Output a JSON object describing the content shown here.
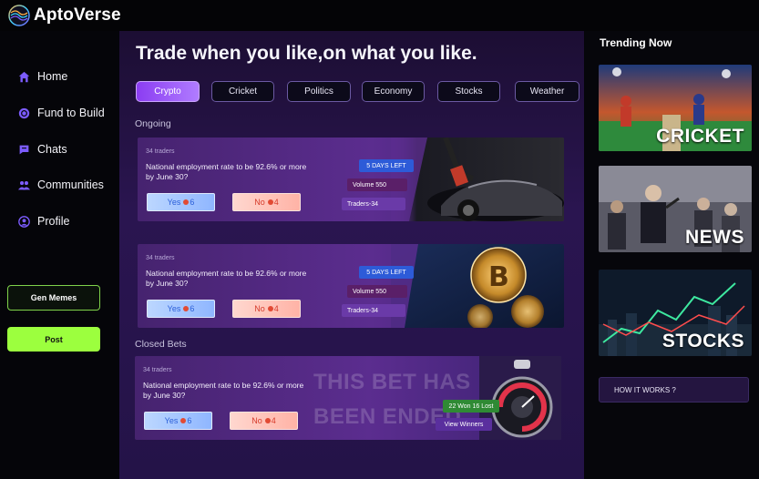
{
  "app": {
    "name": "AptoVerse"
  },
  "sidebar": {
    "items": [
      {
        "label": "Home",
        "icon": "home-icon"
      },
      {
        "label": "Fund to Build",
        "icon": "coin-icon"
      },
      {
        "label": "Chats",
        "icon": "chat-icon"
      },
      {
        "label": "Communities",
        "icon": "users-icon"
      },
      {
        "label": "Profile",
        "icon": "user-icon"
      }
    ],
    "gen_memes_label": "Gen Memes",
    "post_label": "Post"
  },
  "main": {
    "title": "Trade when you like,on what you like.",
    "tabs": [
      "Crypto",
      "Cricket",
      "Politics",
      "Economy",
      "Stocks",
      "Weather"
    ],
    "active_tab": "Crypto",
    "ongoing_label": "Ongoing",
    "closed_label": "Closed Bets",
    "ongoing": [
      {
        "traders": "34 traders",
        "question": "National employment rate to be 92.6% or more by June 30?",
        "yes": "Yes",
        "yes_count": "6",
        "no": "No",
        "no_count": "4",
        "days": "5 DAYS LEFT",
        "volume": "Volume 550",
        "traders_badge": "Traders-34",
        "image": "race-car-fuel-image"
      },
      {
        "traders": "34 traders",
        "question": "National employment rate to be 92.6% or more by June 30?",
        "yes": "Yes",
        "yes_count": "6",
        "no": "No",
        "no_count": "4",
        "days": "5 DAYS LEFT",
        "volume": "Volume 550",
        "traders_badge": "Traders-34",
        "image": "bitcoin-coins-image"
      }
    ],
    "closed": {
      "traders": "34 traders",
      "question": "National employment rate to be 92.6% or more by June 30?",
      "yes": "Yes",
      "yes_count": "6",
      "no": "No",
      "no_count": "4",
      "ended_text": "THIS BET HAS BEEN ENDED",
      "result": "22 Won 16 Lost",
      "view_winners": "View Winners",
      "image": "stopwatch-image"
    }
  },
  "trending": {
    "title": "Trending Now",
    "items": [
      {
        "label": "CRICKET",
        "image": "cricket-stadium-image"
      },
      {
        "label": "NEWS",
        "image": "press-conference-image"
      },
      {
        "label": "STOCKS",
        "image": "stock-chart-image"
      }
    ],
    "how_it_works": "HOW IT WORKS ?"
  },
  "colors": {
    "accent": "#9a5cff",
    "post": "#9cff3e",
    "gen_memes_border": "#7fd34a",
    "main_bg": "#2a1550"
  }
}
